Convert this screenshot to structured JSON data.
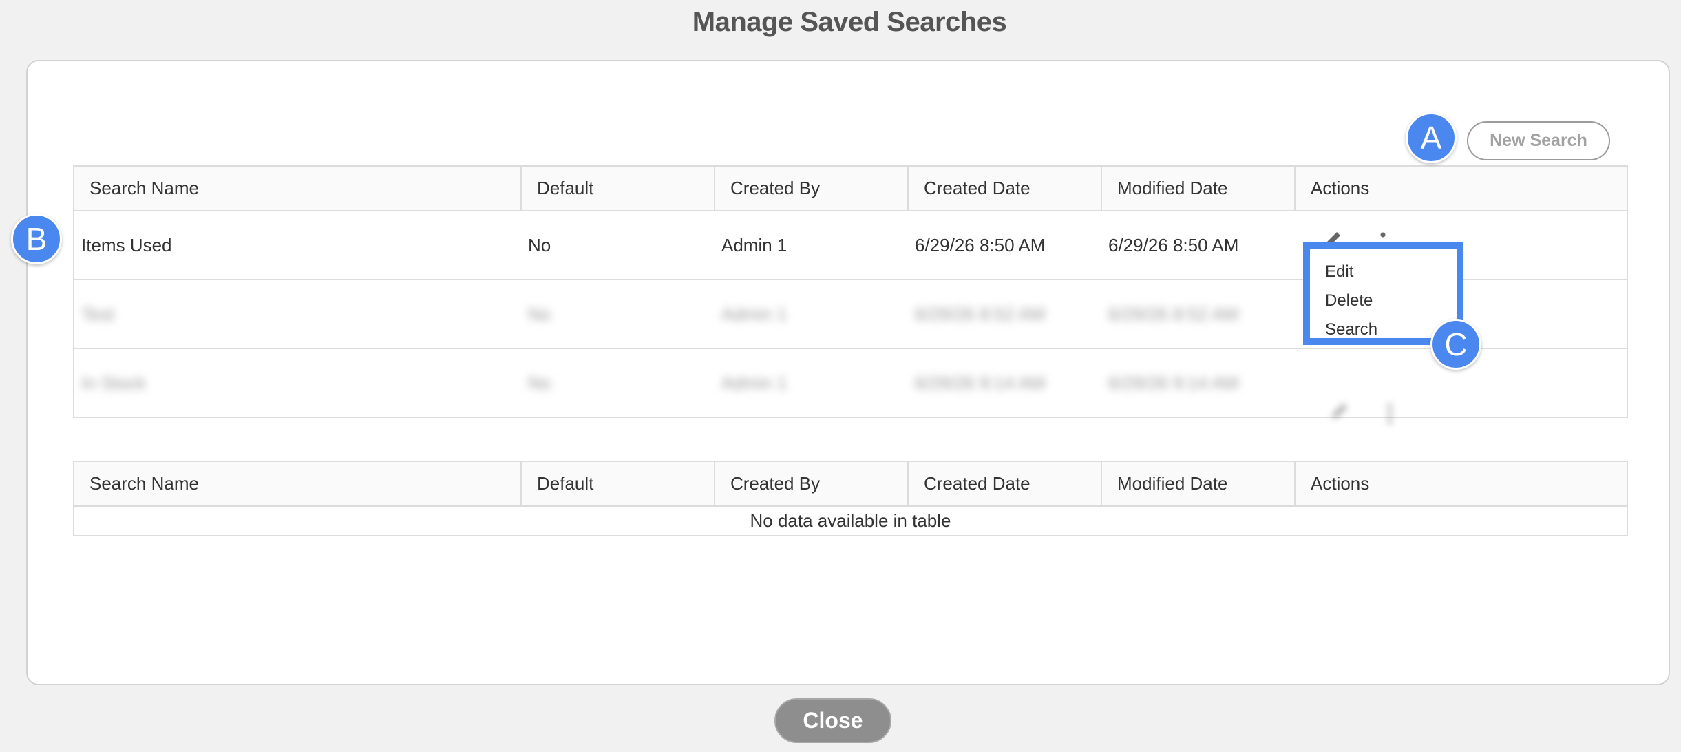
{
  "page_title": "Manage Saved Searches",
  "new_search_label": "New Search",
  "columns": [
    "Search Name",
    "Default",
    "Created By",
    "Created Date",
    "Modified Date",
    "Actions"
  ],
  "saved_searches": {
    "rows": [
      {
        "name": "Items Used",
        "default": "No",
        "created_by": "Admin 1",
        "created_date": "6/29/26 8:50 AM",
        "modified_date": "6/29/26 8:50 AM"
      },
      {
        "name": "Test",
        "default": "No",
        "created_by": "Admin 1",
        "created_date": "6/29/26 8:52 AM",
        "modified_date": "6/29/26 8:52 AM",
        "blurred": true
      },
      {
        "name": "In Stock",
        "default": "No",
        "created_by": "Admin 1",
        "created_date": "6/29/26 9:14 AM",
        "modified_date": "6/29/26 9:14 AM",
        "blurred": true
      }
    ]
  },
  "shared_searches": {
    "empty_message": "No data available in table"
  },
  "action_menu": {
    "items": [
      "Edit",
      "Delete",
      "Search"
    ]
  },
  "annotations": [
    "A",
    "B",
    "C"
  ],
  "close_label": "Close",
  "colors": {
    "accent": "#4a88f0",
    "close_button": "#8e8e8e",
    "background": "#f1f1f1"
  }
}
